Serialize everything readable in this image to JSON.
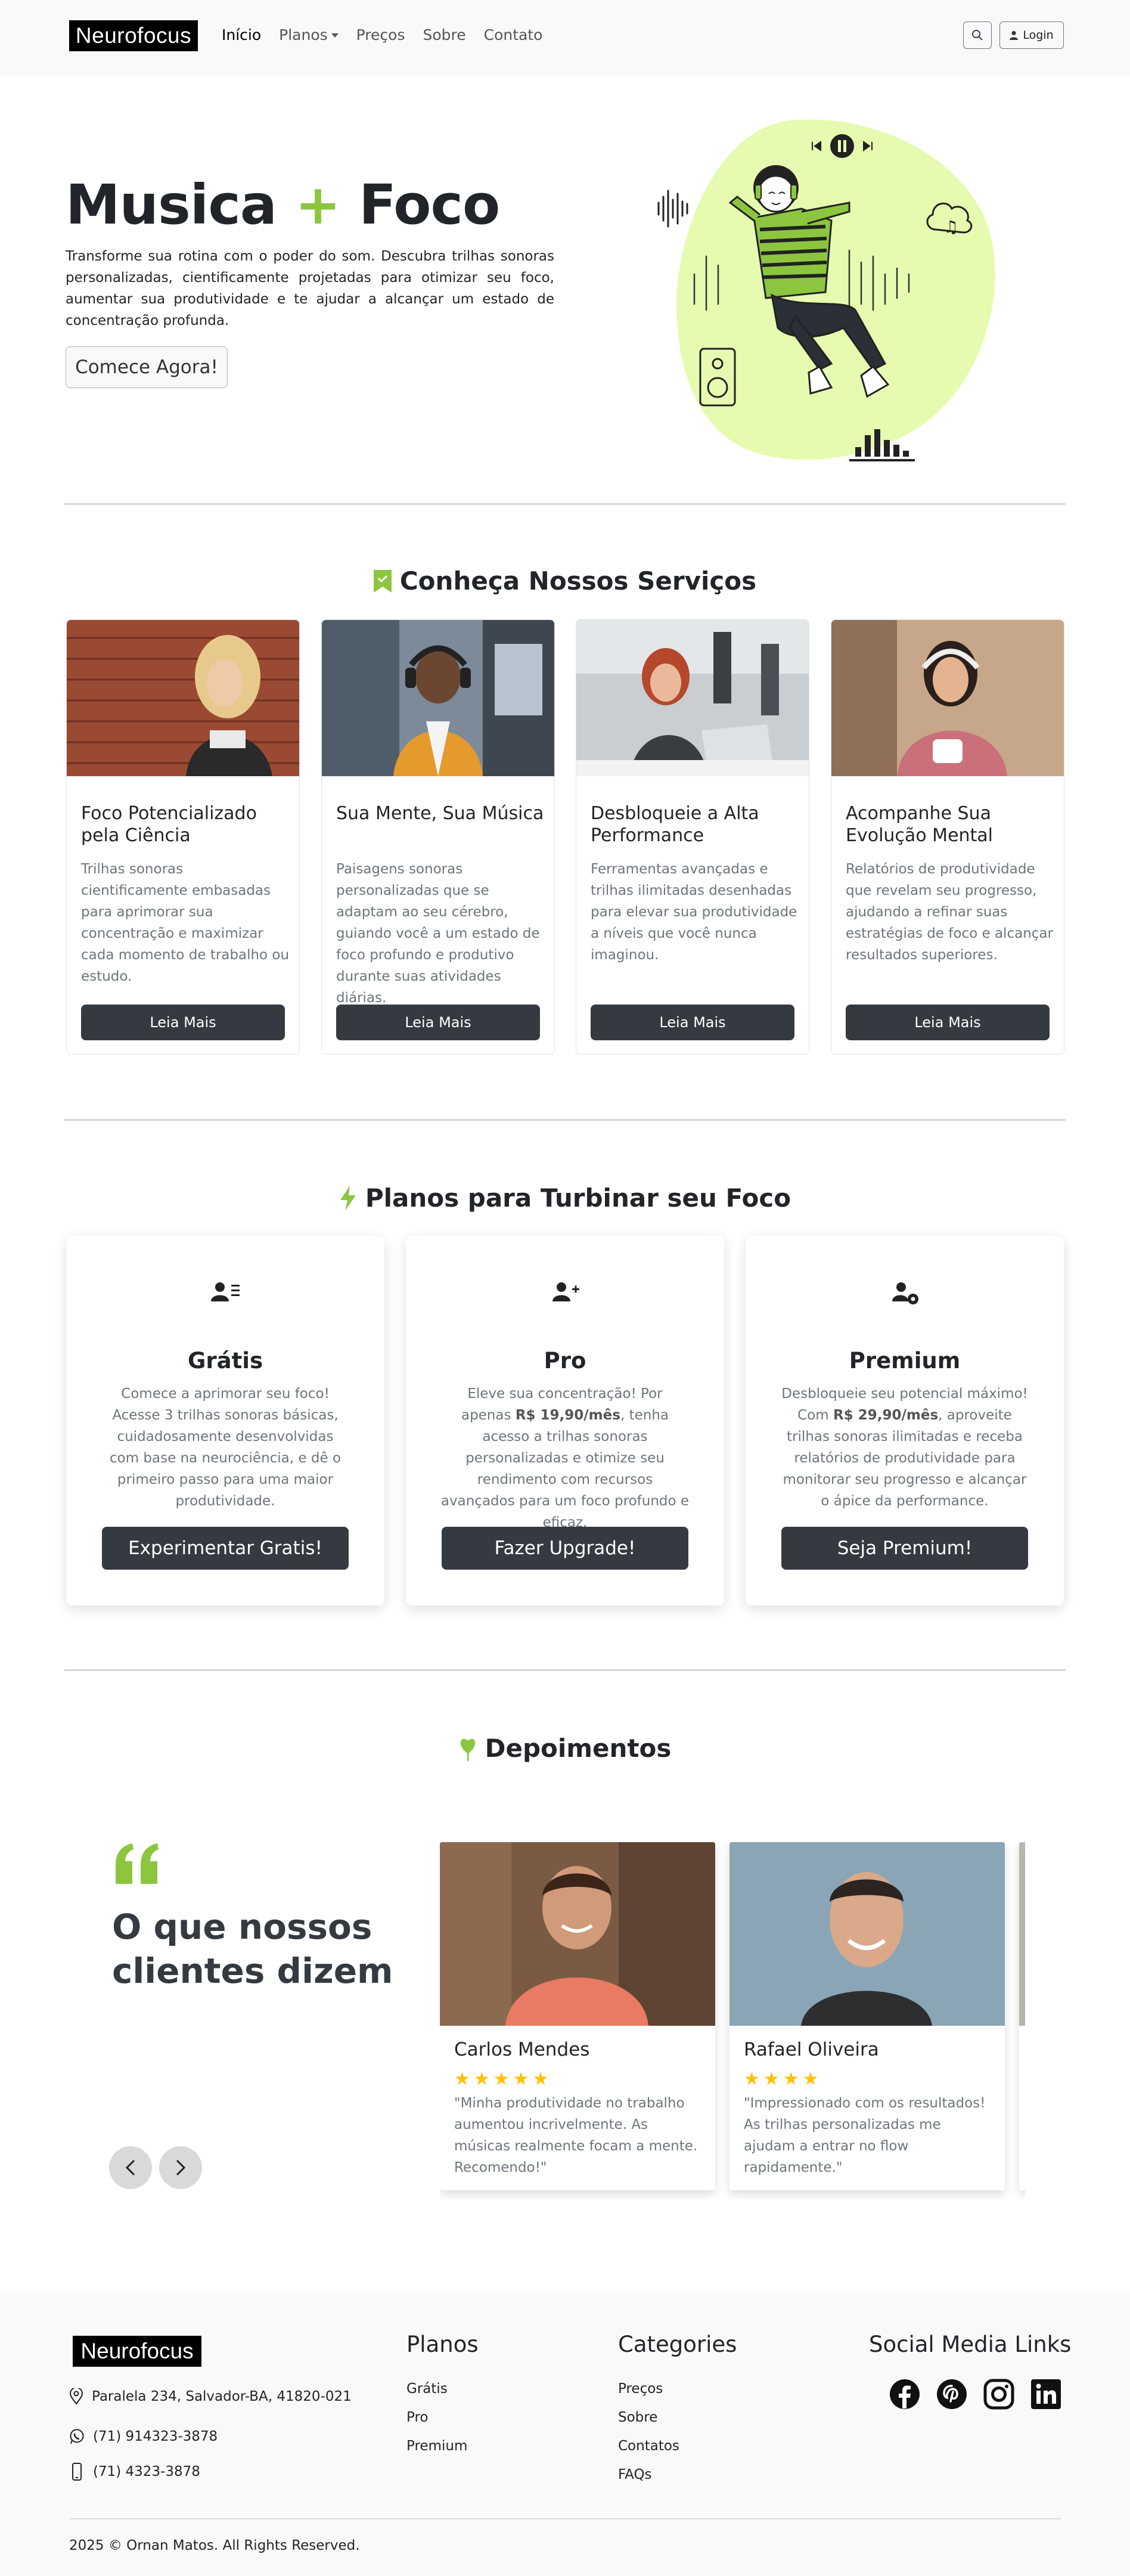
{
  "nav": {
    "brand": "Neurofocus",
    "links": [
      "Início",
      "Planos",
      "Preços",
      "Sobre",
      "Contato"
    ],
    "login": "Login"
  },
  "hero": {
    "title_part1": "Musica",
    "title_plus": "+",
    "title_part2": "Foco",
    "text": "Transforme sua rotina com o poder do som. Descubra trilhas sonoras personalizadas, cientificamente projetadas para otimizar seu foco, aumentar sua produtividade e te ajudar a alcançar um estado de concentração profunda.",
    "button": "Comece Agora!"
  },
  "services": {
    "heading": "Conheça Nossos Serviços",
    "cards": [
      {
        "title": "Foco Potencializado pela Ciência",
        "text": "Trilhas sonoras cientificamente embasadas para aprimorar sua concentração e maximizar cada momento de trabalho ou estudo.",
        "button": "Leia Mais"
      },
      {
        "title": "Sua Mente, Sua Música",
        "text": "Paisagens sonoras personalizadas que se adaptam ao seu cérebro, guiando você a um estado de foco profundo e produtivo durante suas atividades diárias.",
        "button": "Leia Mais"
      },
      {
        "title": "Desbloqueie a Alta Performance",
        "text": "Ferramentas avançadas e trilhas ilimitadas desenhadas para elevar sua produtividade a níveis que você nunca imaginou.",
        "button": "Leia Mais"
      },
      {
        "title": "Acompanhe Sua Evolução Mental",
        "text": "Relatórios de produtividade que revelam seu progresso, ajudando a refinar suas estratégias de foco e alcançar resultados superiores.",
        "button": "Leia Mais"
      }
    ]
  },
  "plans": {
    "heading": "Planos para Turbinar seu Foco",
    "cards": [
      {
        "name": "Grátis",
        "desc_before": "Comece a aprimorar seu foco! Acesse 3 trilhas sonoras básicas, cuidadosamente desenvolvidas com base na neurociência, e dê o primeiro passo para uma maior produtividade.",
        "price": "",
        "desc_after": "",
        "button": "Experimentar Gratis!"
      },
      {
        "name": "Pro",
        "desc_before": "Eleve sua concentração! Por apenas ",
        "price": "R$ 19,90/mês",
        "desc_after": ", tenha acesso a trilhas sonoras personalizadas e otimize seu rendimento com recursos avançados para um foco profundo e eficaz.",
        "button": "Fazer Upgrade!"
      },
      {
        "name": "Premium",
        "desc_before": "Desbloqueie seu potencial máximo! Com ",
        "price": "R$ 29,90/mês",
        "desc_after": ", aproveite trilhas sonoras ilimitadas e receba relatórios de produtividade para monitorar seu progresso e alcançar o ápice da performance.",
        "button": "Seja Premium!"
      }
    ]
  },
  "testimonials": {
    "heading": "Depoimentos",
    "subheading": "O que nossos clientes dizem",
    "stars": "★★★★★",
    "stars_rafael": "★★★★",
    "cards": [
      {
        "name": "Carlos Mendes",
        "rating": 5,
        "text": "\"Minha produtividade no trabalho aumentou incrivelmente. As músicas realmente focam a mente. Recomendo!\""
      },
      {
        "name": "Rafael Oliveira",
        "rating": 4,
        "text": "\"Impressionado com os resultados! As trilhas personalizadas me ajudam a entrar no flow rapidamente.\""
      }
    ]
  },
  "footer": {
    "brand": "Neurofocus",
    "address": "Paralela 234, Salvador-BA, 41820-021",
    "whatsapp": "(71) 914323-3878",
    "phone": "(71) 4323-3878",
    "plans_title": "Planos",
    "plans_links": [
      "Grátis",
      "Pro",
      "Premium"
    ],
    "categories_title": "Categories",
    "categories_links": [
      "Preços",
      "Sobre",
      "Contatos",
      "FAQs"
    ],
    "social_title": "Social Media Links",
    "social_icons": [
      "facebook-icon",
      "pinterest-icon",
      "instagram-icon",
      "linkedin-icon"
    ],
    "copyright": "2025 © Ornan Matos. All Rights Reserved."
  },
  "colors": {
    "accent_green": "#8cc63f",
    "hero_blob": "#e6fbb0",
    "dark_button": "#343a40",
    "star": "#ffc107"
  }
}
